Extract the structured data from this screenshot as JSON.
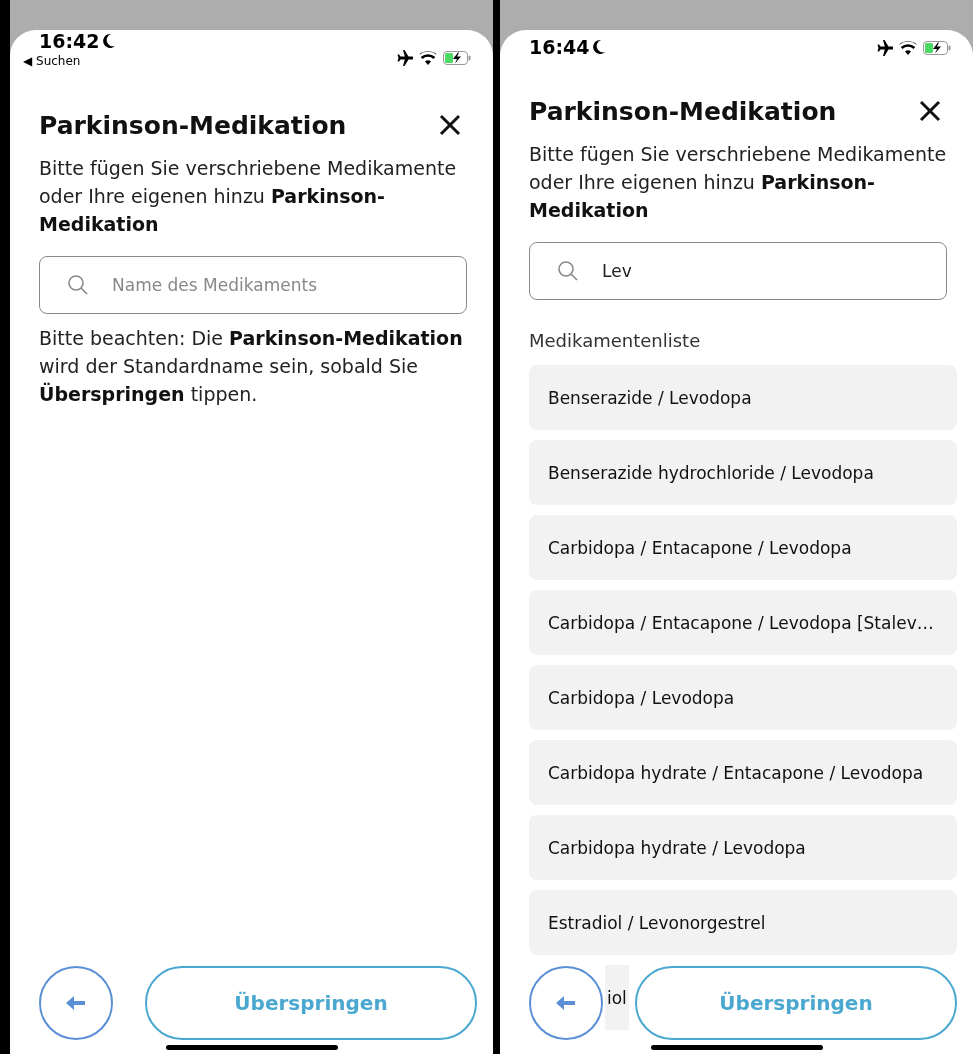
{
  "screens": [
    {
      "status_bar": {
        "time": "16:42",
        "back_link": "◀ Suchen"
      },
      "title": "Parkinson-Medikation",
      "description": "Bitte fügen Sie verschriebene Medikamente oder Ihre eigenen hinzu **Parkinson-Medikation**",
      "search": {
        "placeholder": "Name des Medikaments"
      },
      "note": "Bitte beachten: Die **Parkinson-Medikation** wird der Standardname sein, sobald Sie **Überspringen** tippen.",
      "skip_button": "Überspringen"
    },
    {
      "status_bar": {
        "time": "16:44"
      },
      "title": "Parkinson-Medikation",
      "description": "Bitte fügen Sie verschriebene Medikamente oder Ihre eigenen hinzu **Parkinson-Medikation**",
      "search": {
        "value": "Lev"
      },
      "medication_list": {
        "heading": "Medikamentenliste",
        "items": [
          {
            "kind": "full",
            "label": "Benserazide / Levodopa"
          },
          {
            "kind": "full",
            "label": "Benserazide hydrochloride / Levodopa"
          },
          {
            "kind": "full",
            "label": "Carbidopa / Entacapone / Levodopa"
          },
          {
            "kind": "full",
            "label": "Carbidopa / Entacapone / Levodopa [Stalev…"
          },
          {
            "kind": "full",
            "label": "Carbidopa / Levodopa"
          },
          {
            "kind": "full",
            "label": "Carbidopa hydrate / Entacapone / Levodopa"
          },
          {
            "kind": "full",
            "label": "Carbidopa hydrate / Levodopa"
          },
          {
            "kind": "full",
            "label": "Estradiol / Levonorgestrel"
          },
          {
            "kind": "covered",
            "label": "iol"
          }
        ]
      },
      "skip_button": "Überspringen"
    }
  ]
}
